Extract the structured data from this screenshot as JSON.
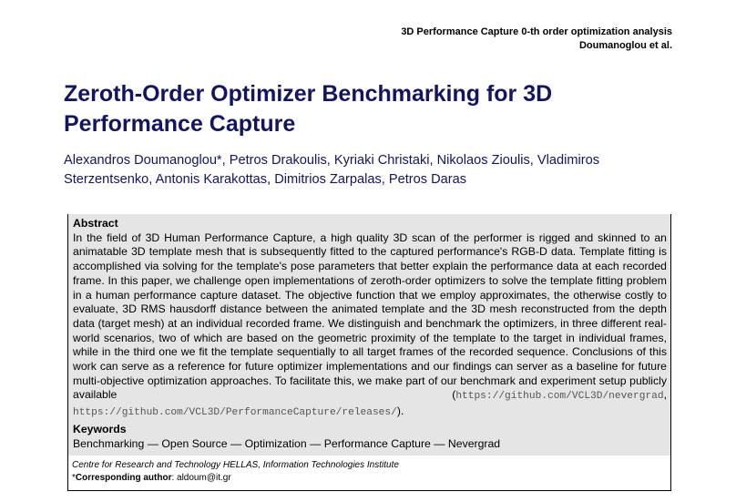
{
  "running_head": {
    "title": "3D Performance Capture 0-th order optimization analysis",
    "authors": "Doumanoglou et al."
  },
  "title": "Zeroth-Order Optimizer Benchmarking for 3D Performance Capture",
  "authors": "Alexandros Doumanoglou*, Petros Drakoulis, Kyriaki Christaki, Nikolaos Zioulis, Vladimiros Sterzentsenko, Antonis Karakottas, Dimitrios Zarpalas, Petros Daras",
  "abstract": {
    "heading": "Abstract",
    "text": "In the field of 3D Human Performance Capture, a high quality 3D scan of the performer is rigged and skinned to an animatable 3D template mesh that is subsequently fitted to the captured performance's RGB-D data. Template fitting is accomplished via solving for the template's pose parameters that better explain the performance data at each recorded frame. In this paper, we challenge open implementations of zeroth-order optimizers to solve the template fitting problem in a human performance capture dataset. The objective function that we employ approximates, the otherwise costly to evaluate, 3D RMS hausdorff distance between the animated template and the 3D mesh reconstructed from the depth data (target mesh) at an individual recorded frame. We distinguish and benchmark the optimizers, in three different real-world scenarios, two of which are based on the geometric proximity of the template to the target in individual frames, while in the third one we fit the template sequentially to all target frames of the recorded sequence. Conclusions of this work can serve as a reference for future optimizer implementations and our findings can server as a baseline for future multi-objective optimization approaches. To facilitate this, we make part of our benchmark and experiment setup publicly available (",
    "link1": "https://github.com/VCL3D/nevergrad",
    "sep": ", ",
    "link2": "https://github.com/VCL3D/PerformanceCapture/releases/",
    "end": ")."
  },
  "keywords": {
    "heading": "Keywords",
    "text": "Benchmarking — Open Source — Optimization — Performance Capture — Nevergrad"
  },
  "footer": {
    "affiliation": "Centre for Research and Technology HELLAS, Information Technologies Institute",
    "corresponding_prefix": "*",
    "corresponding_label": "Corresponding author",
    "corresponding_text": ": aldoum@it.gr"
  }
}
